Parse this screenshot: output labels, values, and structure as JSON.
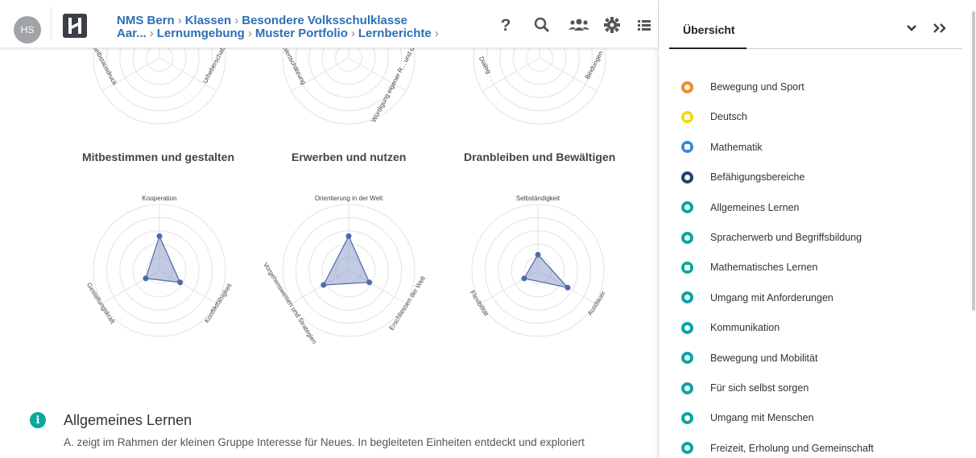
{
  "header": {
    "avatar_initials": "HS",
    "breadcrumb_row1": [
      "NMS Bern",
      "Klassen",
      "Besondere Volksschulklasse"
    ],
    "breadcrumb_row2": [
      "Aar...",
      "Lernumgebung",
      "Muster Portfolio",
      "Lernberichte"
    ],
    "icons": [
      "help-icon",
      "search-icon",
      "users-icon",
      "gear-icon",
      "list-icon"
    ]
  },
  "top_charts": [
    {
      "axis_labels": [
        "Selbstausdruck",
        "Urheberschaft"
      ]
    },
    {
      "axis_labels": [
        "Wertschätzung",
        "Würdigung eigener R... und die des andere..."
      ]
    },
    {
      "axis_labels": [
        "Dialog",
        "Bindungen"
      ]
    }
  ],
  "chart_data": [
    {
      "type": "radar",
      "title": "Mitbestimmen und gestalten",
      "axes": [
        "Kooperation",
        "Konfliktfähigkeit",
        "Gestaltungskraft"
      ],
      "values": [
        1.3,
        0.9,
        0.6
      ],
      "range": [
        0,
        5
      ],
      "grid": true
    },
    {
      "type": "radar",
      "title": "Erwerben und nutzen",
      "axes": [
        "Orientierung in der Welt",
        "Erschliessen der Welt",
        "Vorgehensweisen und Strategien"
      ],
      "values": [
        1.3,
        0.9,
        1.1
      ],
      "range": [
        0,
        5
      ],
      "grid": true
    },
    {
      "type": "radar",
      "title": "Dranbleiben und Bewältigen",
      "axes": [
        "Selbständigkeit",
        "Ausdauer",
        "Flexibilität"
      ],
      "values": [
        0.6,
        1.3,
        0.6
      ],
      "range": [
        0,
        5
      ],
      "grid": true
    }
  ],
  "section": {
    "title": "Allgemeines Lernen",
    "text": "A. zeigt im Rahmen der kleinen Gruppe Interesse für Neues. In begleiteten Einheiten entdeckt und exploriert"
  },
  "panel": {
    "tab_label": "Übersicht",
    "items": [
      {
        "label": "Bewegung und Sport",
        "color": "#f08a24",
        "icon": "gear-icon"
      },
      {
        "label": "Deutsch",
        "color": "#f5d60a",
        "icon": "square-icon"
      },
      {
        "label": "Mathematik",
        "color": "#3a87d6",
        "icon": "calculator-icon"
      },
      {
        "label": "Befähigungsbereiche",
        "color": "#27406b",
        "icon": "gear-icon"
      },
      {
        "label": "Allgemeines Lernen",
        "color": "#0aa6a0",
        "icon": "info-icon"
      },
      {
        "label": "Spracherwerb und Begriffsbildung",
        "color": "#0aa6a0",
        "icon": "speech-icon"
      },
      {
        "label": "Mathematisches Lernen",
        "color": "#0aa6a0",
        "icon": "calculator-icon"
      },
      {
        "label": "Umgang mit Anforderungen",
        "color": "#0aa6a0",
        "icon": "mountain-icon"
      },
      {
        "label": "Kommunikation",
        "color": "#0aa6a0",
        "icon": "chat-icon"
      },
      {
        "label": "Bewegung und Mobilität",
        "color": "#0aa6a0",
        "icon": "running-icon"
      },
      {
        "label": "Für sich selbst sorgen",
        "color": "#0aa6a0",
        "icon": "person-icon"
      },
      {
        "label": "Umgang mit Menschen",
        "color": "#0aa6a0",
        "icon": "users-icon"
      },
      {
        "label": "Freizeit, Erholung und Gemeinschaft",
        "color": "#0aa6a0",
        "icon": "drop-icon"
      }
    ]
  }
}
